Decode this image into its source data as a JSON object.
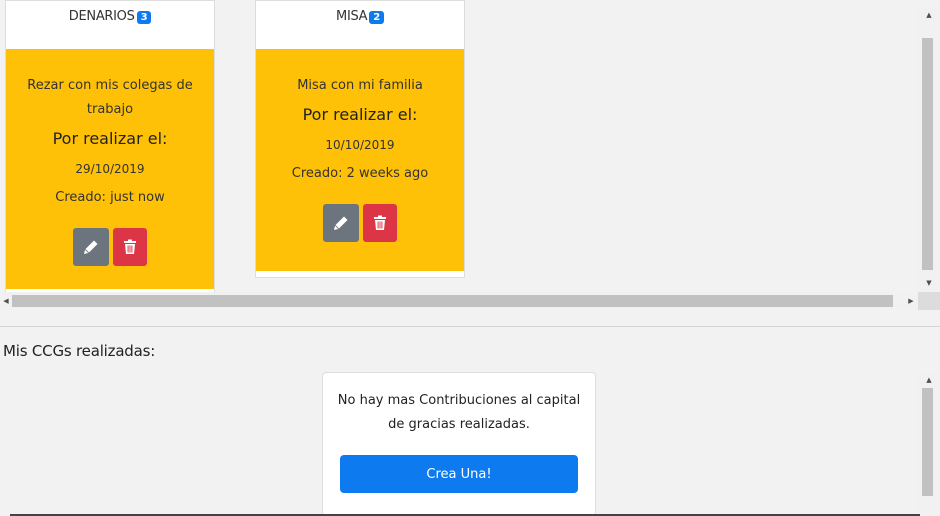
{
  "pending_cards": [
    {
      "category": "DENARIOS",
      "count": "3",
      "description": "Rezar con mis colegas de trabajo",
      "due_label": "Por realizar el:",
      "due_date": "29/10/2019",
      "created": "Creado: just now",
      "edit_icon": "pencil-icon",
      "delete_icon": "trash-icon"
    },
    {
      "category": "MISA",
      "count": "2",
      "description": "Misa con mi familia",
      "due_label": "Por realizar el:",
      "due_date": "10/10/2019",
      "created": "Creado: 2 weeks ago",
      "edit_icon": "pencil-icon",
      "delete_icon": "trash-icon"
    }
  ],
  "completed_section": {
    "title": "Mis CCGs realizadas:",
    "empty_message": "No hay mas Contribuciones al capital de gracias realizadas.",
    "create_button": "Crea Una!"
  },
  "colors": {
    "card_body": "#ffc107",
    "badge": "#0d7af0",
    "edit_button": "#6c757d",
    "delete_button": "#dc3545",
    "primary_button": "#0d7af0"
  }
}
